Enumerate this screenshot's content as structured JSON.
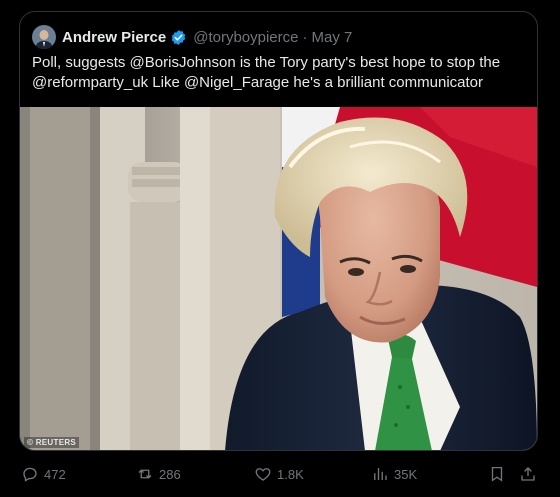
{
  "quoted_post": {
    "author_name": "Andrew Pierce",
    "author_handle": "@toryboypierce",
    "separator": "·",
    "date": "May 7",
    "verified_icon": "verified-badge-icon",
    "text": "Poll, suggests @BorisJohnson is the Tory party's best hope to stop the @reformparty_uk Like @Nigel_Farage he's a brilliant communicator",
    "media": {
      "credit": "© REUTERS"
    }
  },
  "actions": {
    "replies": "472",
    "reposts": "286",
    "likes": "1.8K",
    "views": "35K"
  },
  "colors": {
    "background": "#000000",
    "text": "#e7e9ea",
    "muted": "#71767b",
    "border": "#2f3336",
    "verified": "#1d9bf0"
  }
}
